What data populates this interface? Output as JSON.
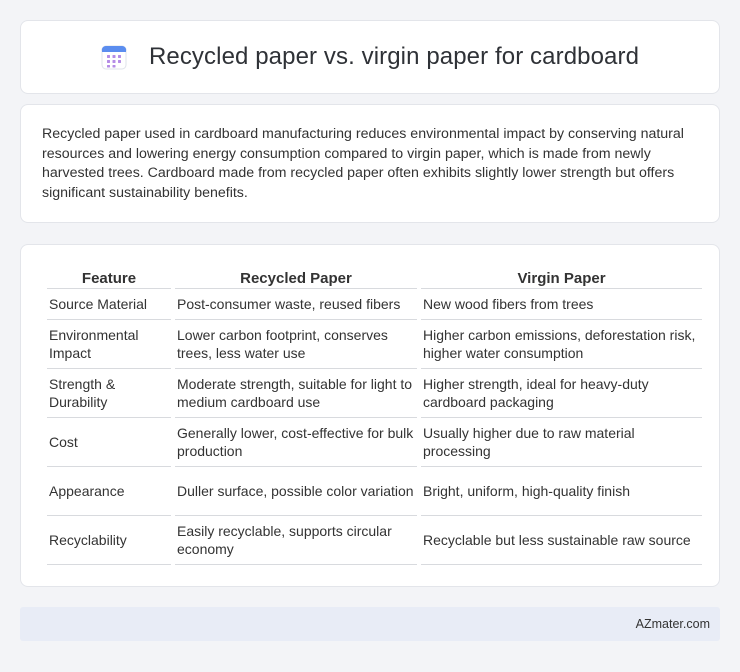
{
  "header": {
    "title": "Recycled paper vs. virgin paper for cardboard",
    "icon": "calendar-icon",
    "icon_color": "#5b8def",
    "icon_grid_color": "#b58de6"
  },
  "intro": {
    "text": "Recycled paper used in cardboard manufacturing reduces environmental impact by conserving natural resources and lowering energy consumption compared to virgin paper, which is made from newly harvested trees. Cardboard made from recycled paper often exhibits slightly lower strength but offers significant sustainability benefits."
  },
  "table": {
    "headers": [
      "Feature",
      "Recycled Paper",
      "Virgin Paper"
    ],
    "rows": [
      [
        "Source Material",
        "Post-consumer waste, reused fibers",
        "New wood fibers from trees"
      ],
      [
        "Environmental Impact",
        "Lower carbon footprint, conserves trees, less water use",
        "Higher carbon emissions, deforestation risk, higher water consumption"
      ],
      [
        "Strength & Durability",
        "Moderate strength, suitable for light to medium cardboard use",
        "Higher strength, ideal for heavy-duty cardboard packaging"
      ],
      [
        "Cost",
        "Generally lower, cost-effective for bulk production",
        "Usually higher due to raw material processing"
      ],
      [
        "Appearance",
        "Duller surface, possible color variation",
        "Bright, uniform, high-quality finish"
      ],
      [
        "Recyclability",
        "Easily recyclable, supports circular economy",
        "Recyclable but less sustainable raw source"
      ]
    ]
  },
  "footer": {
    "text": "AZmater.com"
  }
}
